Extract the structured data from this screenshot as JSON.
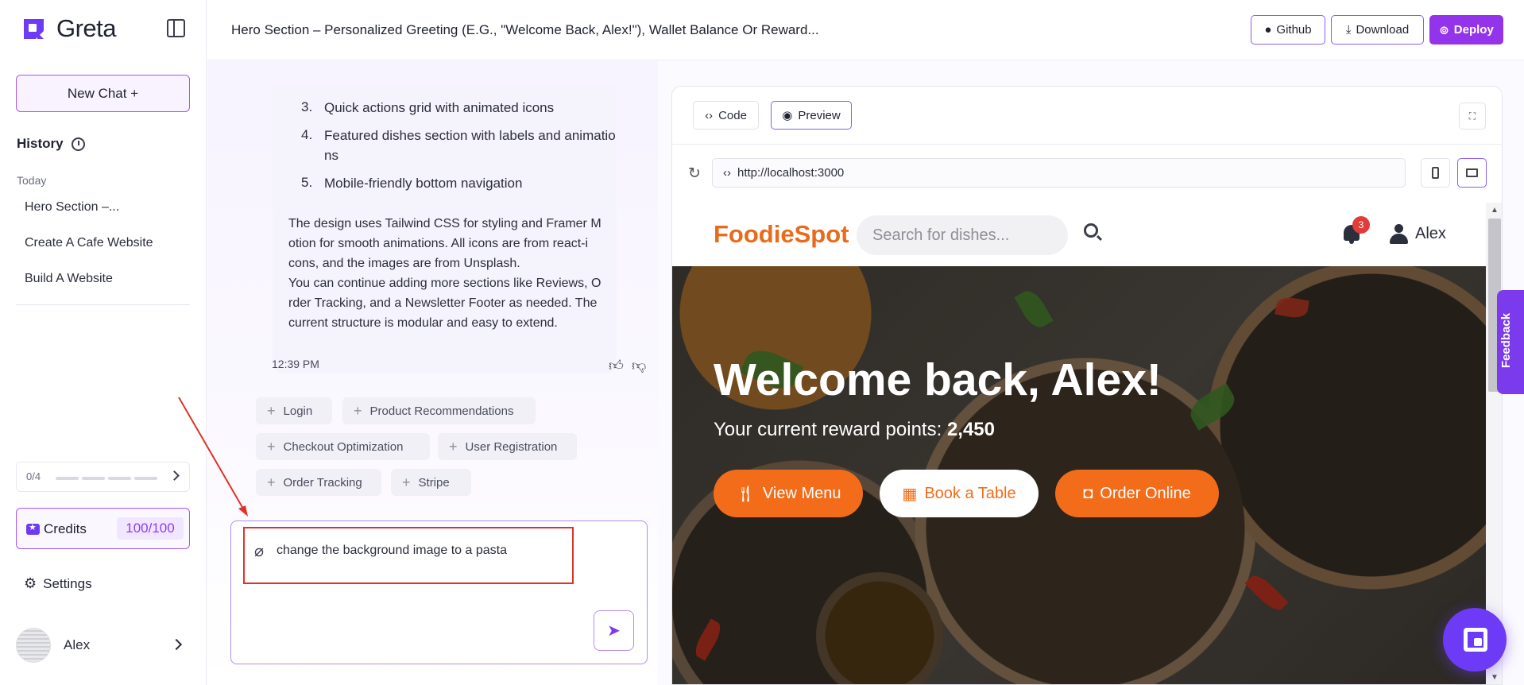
{
  "app": {
    "name": "Greta",
    "accent": "#9333ea",
    "brand_orange": "#f36c1a"
  },
  "sidebar": {
    "new_chat_label": "New Chat +",
    "history_label": "History",
    "today_label": "Today",
    "history_items": [
      {
        "label": "Hero Section –..."
      },
      {
        "label": "Create A Cafe Website"
      },
      {
        "label": "Build A Website"
      }
    ],
    "progress_text": "0/4",
    "credits_label": "Credits",
    "credits_value": "100/100",
    "settings_label": "Settings",
    "user_name": "Alex"
  },
  "header": {
    "title": "Hero Section – Personalized Greeting (E.G., \"Welcome Back, Alex!\"), Wallet Balance Or Reward...",
    "github_label": "Github",
    "download_label": "Download",
    "deploy_label": "Deploy"
  },
  "chat": {
    "list_numbers": [
      "3.",
      "4.",
      "5."
    ],
    "list_items": [
      "Quick actions grid with animated icons",
      "Featured dishes section with labels and animatio",
      "ns",
      "Mobile-friendly bottom navigation"
    ],
    "paragraph_lines": [
      "The design uses Tailwind CSS for styling and Framer M",
      "otion for smooth animations. All icons are from react-i",
      "cons, and the images are from Unsplash.",
      "You can continue adding more sections like Reviews, O",
      "rder Tracking, and a Newsletter Footer as needed. The",
      "current structure is modular and easy to extend."
    ],
    "timestamp": "12:39 PM",
    "suggestions": [
      "Login",
      "Product Recommendations",
      "Checkout Optimization",
      "User Registration",
      "Order Tracking",
      "Stripe"
    ],
    "input_value": "change the background image to a pasta"
  },
  "preview": {
    "code_tab": "Code",
    "preview_tab": "Preview",
    "url": "http://localhost:3000",
    "site": {
      "logo": "FoodieSpot",
      "search_placeholder": "Search for dishes...",
      "notification_count": "3",
      "user_name": "Alex",
      "hero_title": "Welcome back, Alex!",
      "hero_sub_prefix": "Your current reward points: ",
      "hero_points": "2,450",
      "buttons": [
        "View Menu",
        "Book a Table",
        "Order Online"
      ]
    }
  },
  "feedback_label": "Feedback"
}
